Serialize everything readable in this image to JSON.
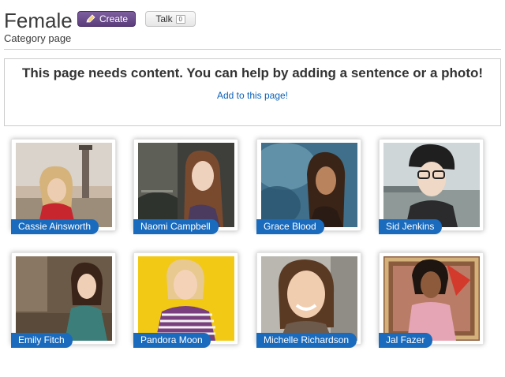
{
  "page": {
    "title": "Female",
    "subtitle": "Category page",
    "create_label": "Create",
    "talk_label": "Talk",
    "talk_count": "0"
  },
  "notice": {
    "text": "This page needs content. You can help by adding a sentence or a photo!",
    "link": "Add to this page!"
  },
  "characters": [
    {
      "name": "Cassie Ainsworth"
    },
    {
      "name": "Naomi Campbell"
    },
    {
      "name": "Grace Blood"
    },
    {
      "name": "Sid Jenkins"
    },
    {
      "name": "Emily Fitch"
    },
    {
      "name": "Pandora Moon"
    },
    {
      "name": "Michelle Richardson"
    },
    {
      "name": "Jal Fazer"
    }
  ],
  "colors": {
    "create_button": "#6b4c8e",
    "name_tag": "#1a6bbd",
    "link": "#0b61b8"
  }
}
